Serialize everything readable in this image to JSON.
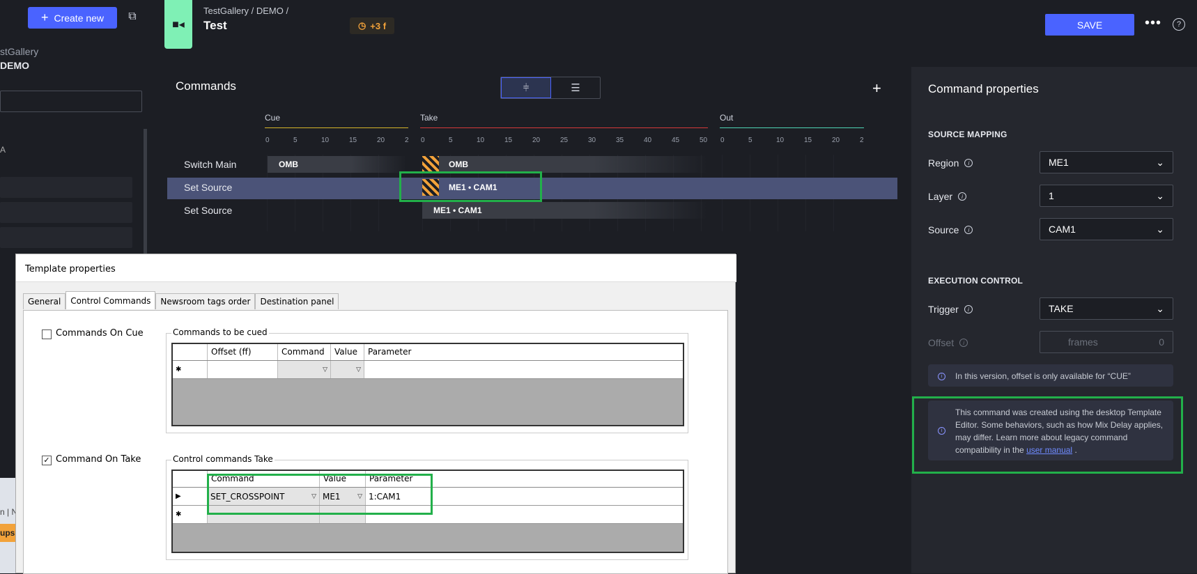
{
  "sidebar": {
    "create_label": "Create new",
    "gallery": "stGallery",
    "demo": "DEMO",
    "item_a": "A"
  },
  "header": {
    "breadcrumb": "TestGallery / DEMO /",
    "title": "Test",
    "delay": "+3 f",
    "save_label": "SAVE"
  },
  "timeline": {
    "title": "Commands",
    "phases": [
      {
        "name": "Cue",
        "color": "#d6b52a",
        "ticks": [
          "0",
          "5",
          "10",
          "15",
          "20",
          "2"
        ]
      },
      {
        "name": "Take",
        "color": "#d63a3a",
        "ticks": [
          "0",
          "5",
          "10",
          "15",
          "20",
          "25",
          "30",
          "35",
          "40",
          "45",
          "50"
        ]
      },
      {
        "name": "Out",
        "color": "#4fd6b5",
        "ticks": [
          "0",
          "5",
          "10",
          "15",
          "20",
          "2"
        ]
      }
    ],
    "rows": [
      {
        "label": "Switch Main",
        "cue_bar": "OMB",
        "take_bar": "OMB"
      },
      {
        "label": "Set Source",
        "take_bar": "ME1 • CAM1"
      },
      {
        "label": "Set Source",
        "take_bar": "ME1 • CAM1"
      }
    ]
  },
  "props": {
    "title": "Command properties",
    "source_mapping": "SOURCE MAPPING",
    "region_label": "Region",
    "region_value": "ME1",
    "layer_label": "Layer",
    "layer_value": "1",
    "source_label": "Source",
    "source_value": "CAM1",
    "execution_control": "EXECUTION CONTROL",
    "trigger_label": "Trigger",
    "trigger_value": "TAKE",
    "offset_label": "Offset",
    "offset_placeholder": "frames",
    "offset_value": "0",
    "note_offset": "In this version, offset is only available for “CUE”",
    "note_legacy": "This command was created using the desktop Template Editor. Some behaviors, such as how Mix Delay applies, may differ. Learn more about legacy command compatibility in the",
    "note_link": "user manual",
    "note_end": "."
  },
  "dialog": {
    "title": "Template properties",
    "tabs": [
      "General",
      "Control Commands",
      "Newsroom tags order",
      "Destination panel"
    ],
    "cue_check": "Commands On Cue",
    "cue_group": "Commands to be cued",
    "cue_cols": [
      "Offset (ff)",
      "Command",
      "Value",
      "Parameter"
    ],
    "take_check": "Command On Take",
    "take_group": "Control commands Take",
    "take_cols": [
      "Command",
      "Value",
      "Parameter"
    ],
    "take_row": {
      "command": "SET_CROSSPOINT",
      "value": "ME1",
      "parameter": "1:CAM1"
    },
    "side_text1": "n | N",
    "side_text2": "ups"
  }
}
